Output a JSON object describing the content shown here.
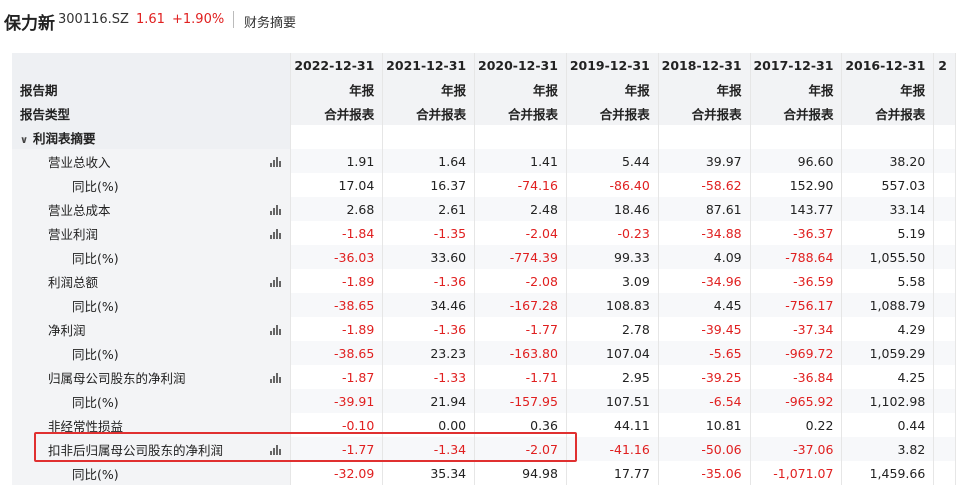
{
  "header": {
    "stock_name": "保力新",
    "stock_code": "300116.SZ",
    "price": "1.61",
    "change": "+1.90%",
    "section": "财务摘要"
  },
  "columns": [
    "2022-12-31",
    "2021-12-31",
    "2020-12-31",
    "2019-12-31",
    "2018-12-31",
    "2017-12-31",
    "2016-12-31"
  ],
  "partial_column": "2",
  "header_rows": [
    {
      "label": "报告期",
      "values": [
        "年报",
        "年报",
        "年报",
        "年报",
        "年报",
        "年报",
        "年报"
      ]
    },
    {
      "label": "报告类型",
      "values": [
        "合并报表",
        "合并报表",
        "合并报表",
        "合并报表",
        "合并报表",
        "合并报表",
        "合并报表"
      ]
    }
  ],
  "section_label": "利润表摘要",
  "rows": [
    {
      "label": "营业总收入",
      "level": 1,
      "chart": true,
      "values": [
        "1.91",
        "1.64",
        "1.41",
        "5.44",
        "39.97",
        "96.60",
        "38.20"
      ]
    },
    {
      "label": "同比(%)",
      "level": 2,
      "chart": false,
      "values": [
        "17.04",
        "16.37",
        "-74.16",
        "-86.40",
        "-58.62",
        "152.90",
        "557.03"
      ]
    },
    {
      "label": "营业总成本",
      "level": 1,
      "chart": true,
      "values": [
        "2.68",
        "2.61",
        "2.48",
        "18.46",
        "87.61",
        "143.77",
        "33.14"
      ]
    },
    {
      "label": "营业利润",
      "level": 1,
      "chart": true,
      "values": [
        "-1.84",
        "-1.35",
        "-2.04",
        "-0.23",
        "-34.88",
        "-36.37",
        "5.19"
      ]
    },
    {
      "label": "同比(%)",
      "level": 2,
      "chart": false,
      "values": [
        "-36.03",
        "33.60",
        "-774.39",
        "99.33",
        "4.09",
        "-788.64",
        "1,055.50"
      ]
    },
    {
      "label": "利润总额",
      "level": 1,
      "chart": true,
      "values": [
        "-1.89",
        "-1.36",
        "-2.08",
        "3.09",
        "-34.96",
        "-36.59",
        "5.58"
      ]
    },
    {
      "label": "同比(%)",
      "level": 2,
      "chart": false,
      "values": [
        "-38.65",
        "34.46",
        "-167.28",
        "108.83",
        "4.45",
        "-756.17",
        "1,088.79"
      ]
    },
    {
      "label": "净利润",
      "level": 1,
      "chart": true,
      "values": [
        "-1.89",
        "-1.36",
        "-1.77",
        "2.78",
        "-39.45",
        "-37.34",
        "4.29"
      ]
    },
    {
      "label": "同比(%)",
      "level": 2,
      "chart": false,
      "values": [
        "-38.65",
        "23.23",
        "-163.80",
        "107.04",
        "-5.65",
        "-969.72",
        "1,059.29"
      ]
    },
    {
      "label": "归属母公司股东的净利润",
      "level": 1,
      "chart": true,
      "values": [
        "-1.87",
        "-1.33",
        "-1.71",
        "2.95",
        "-39.25",
        "-36.84",
        "4.25"
      ]
    },
    {
      "label": "同比(%)",
      "level": 2,
      "chart": false,
      "values": [
        "-39.91",
        "21.94",
        "-157.95",
        "107.51",
        "-6.54",
        "-965.92",
        "1,102.98"
      ]
    },
    {
      "label": "非经常性损益",
      "level": 1,
      "chart": false,
      "values": [
        "-0.10",
        "0.00",
        "0.36",
        "44.11",
        "10.81",
        "0.22",
        "0.44"
      ]
    },
    {
      "label": "扣非后归属母公司股东的净利润",
      "level": 1,
      "chart": true,
      "values": [
        "-1.77",
        "-1.34",
        "-2.07",
        "-41.16",
        "-50.06",
        "-37.06",
        "3.82"
      ]
    },
    {
      "label": "同比(%)",
      "level": 2,
      "chart": false,
      "values": [
        "-32.09",
        "35.34",
        "94.98",
        "17.77",
        "-35.06",
        "-1,071.07",
        "1,459.66"
      ]
    }
  ],
  "colors": {
    "negative": "#e02020",
    "highlight": "#e03030"
  }
}
